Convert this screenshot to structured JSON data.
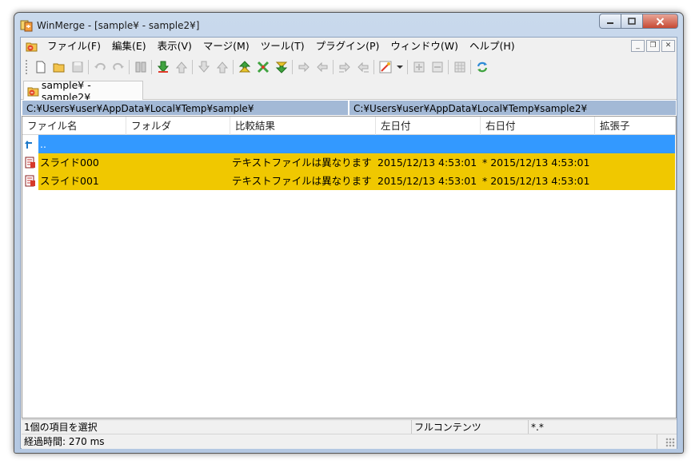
{
  "window": {
    "title": "WinMerge - [sample¥ - sample2¥]"
  },
  "menu": {
    "items": [
      "ファイル(F)",
      "編集(E)",
      "表示(V)",
      "マージ(M)",
      "ツール(T)",
      "プラグイン(P)",
      "ウィンドウ(W)",
      "ヘルプ(H)"
    ]
  },
  "tab": {
    "label": "sample¥ - sample2¥"
  },
  "paths": {
    "left": "C:¥Users¥user¥AppData¥Local¥Temp¥sample¥",
    "right": "C:¥Users¥user¥AppData¥Local¥Temp¥sample2¥"
  },
  "columns": [
    "ファイル名",
    "フォルダ",
    "比較結果",
    "左日付",
    "右日付",
    "拡張子"
  ],
  "rows": [
    {
      "name": "..",
      "folder": "",
      "result": "",
      "left_date": "",
      "right_date": "",
      "ext": ""
    },
    {
      "name": "スライド000",
      "folder": "",
      "result": "テキストファイルは異なります",
      "left_date": "2015/12/13 4:53:01",
      "right_date": "* 2015/12/13 4:53:01",
      "ext": ""
    },
    {
      "name": "スライド001",
      "folder": "",
      "result": "テキストファイルは異なります",
      "left_date": "2015/12/13 4:53:01",
      "right_date": "* 2015/12/13 4:53:01",
      "ext": ""
    }
  ],
  "status": {
    "selection": "1個の項目を選択",
    "compare_method": "フルコンテンツ",
    "filter": "*.*",
    "elapsed": "経過時間: 270 ms"
  },
  "colors": {
    "selected_row": "#3399ff",
    "diff_row": "#f0c800",
    "path_bar": "#a3b9d6"
  }
}
